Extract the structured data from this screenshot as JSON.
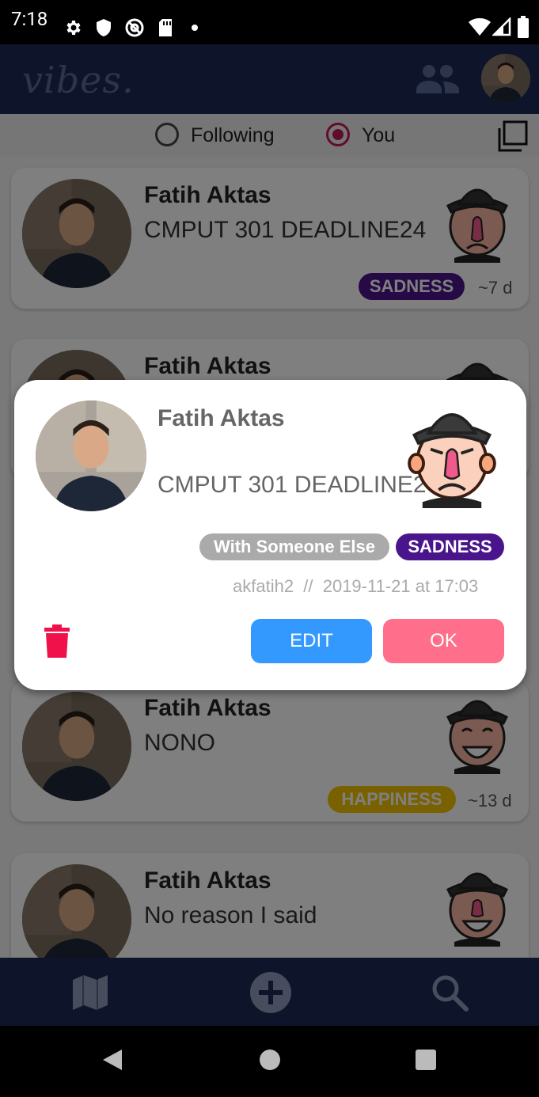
{
  "status_bar": {
    "time": "7:18"
  },
  "app_bar": {
    "logo": "vibes."
  },
  "filter_tabs": {
    "following_label": "Following",
    "you_label": "You",
    "selected": "You"
  },
  "feed": [
    {
      "name": "Fatih Aktas",
      "reason": "CMPUT 301 DEADLINE24",
      "emotion": "SADNESS",
      "emotion_color": "#4a148c",
      "ago": "~7 d"
    },
    {
      "name": "Fatih Aktas",
      "reason": "",
      "emotion": "",
      "emotion_color": "",
      "ago": ""
    },
    {
      "name": "Fatih Aktas",
      "reason": "NONO",
      "emotion": "HAPPINESS",
      "emotion_color": "#f2c300",
      "ago": "~13 d"
    },
    {
      "name": "Fatih Aktas",
      "reason": "No reason I said",
      "emotion": "",
      "emotion_color": "",
      "ago": ""
    }
  ],
  "dialog": {
    "name": "Fatih Aktas",
    "reason": "CMPUT 301 DEADLINE24",
    "social_situation": "With Someone Else",
    "emotion": "SADNESS",
    "emotion_color": "#4a148c",
    "meta": "akfatih2  //  2019-11-21 at 17:03",
    "edit_label": "EDIT",
    "ok_label": "OK",
    "colors": {
      "edit": "#3399ff",
      "ok": "#ff6e8a",
      "delete": "#f0104a"
    }
  },
  "icons": {
    "status": [
      "gear-icon",
      "shield-icon",
      "at-icon",
      "sd-card-icon",
      "dot-icon",
      "wifi-icon",
      "signal-icon",
      "battery-icon"
    ],
    "app_bar": [
      "people-icon",
      "profile-avatar"
    ],
    "bottom_nav": [
      "map-icon",
      "add-circle-icon",
      "search-icon"
    ],
    "system_nav": [
      "back-icon",
      "home-icon",
      "recents-icon"
    ]
  },
  "colors": {
    "app_bar": "#1c2a57",
    "accent": "#c2185b"
  }
}
